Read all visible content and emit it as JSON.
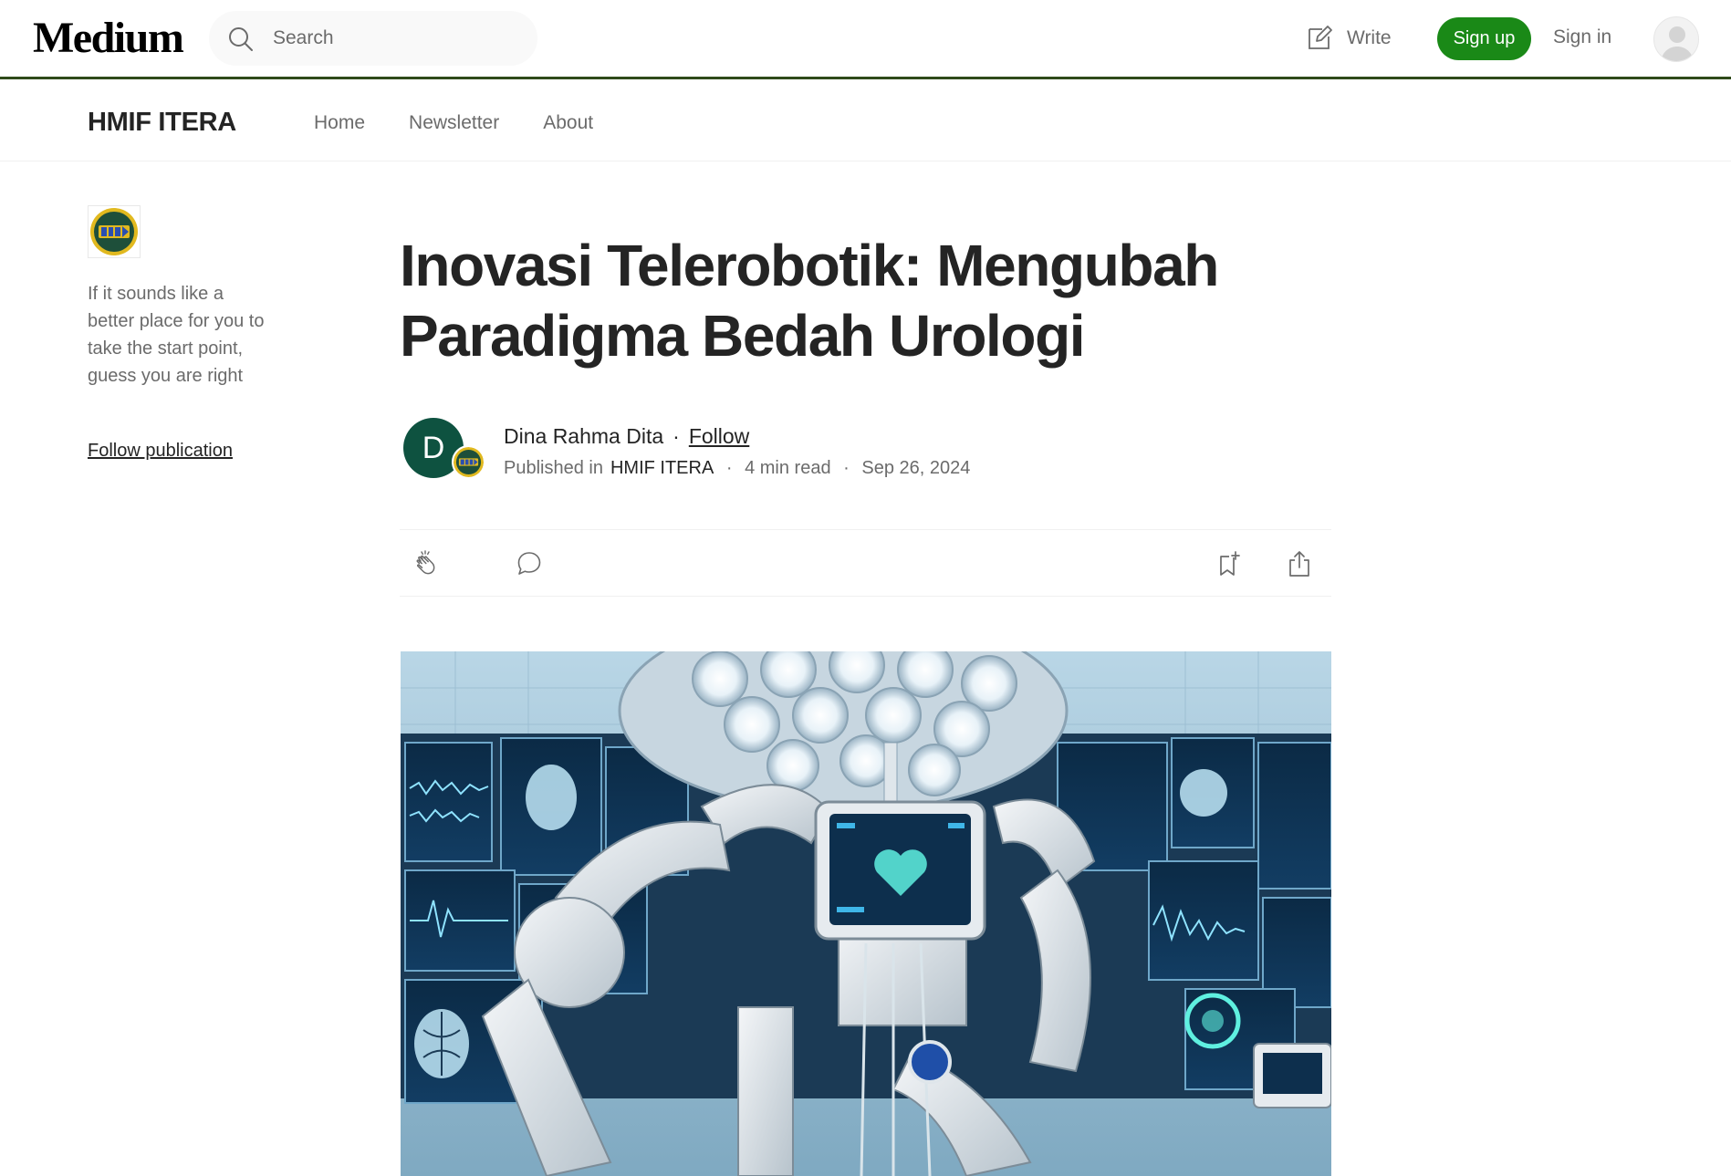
{
  "header": {
    "logo": "Medium",
    "search_placeholder": "Search",
    "write_label": "Write",
    "signup_label": "Sign up",
    "signin_label": "Sign in"
  },
  "publication": {
    "name": "HMIF ITERA",
    "nav": [
      "Home",
      "Newsletter",
      "About"
    ],
    "description": "If it sounds like a better place for you to take the start point, guess you are right",
    "follow_label": "Follow publication"
  },
  "article": {
    "title": "Inovasi Telerobotik: Mengubah Paradigma Bedah Urologi",
    "author_initial": "D",
    "author_name": "Dina Rahma Dita",
    "follow_label": "Follow",
    "published_in_label": "Published in",
    "publication": "HMIF ITERA",
    "read_time": "4 min read",
    "date": "Sep 26, 2024"
  },
  "colors": {
    "brand_green": "#1a8917",
    "header_border": "#2f4a1a",
    "author_avatar_bg": "#0e5240"
  }
}
